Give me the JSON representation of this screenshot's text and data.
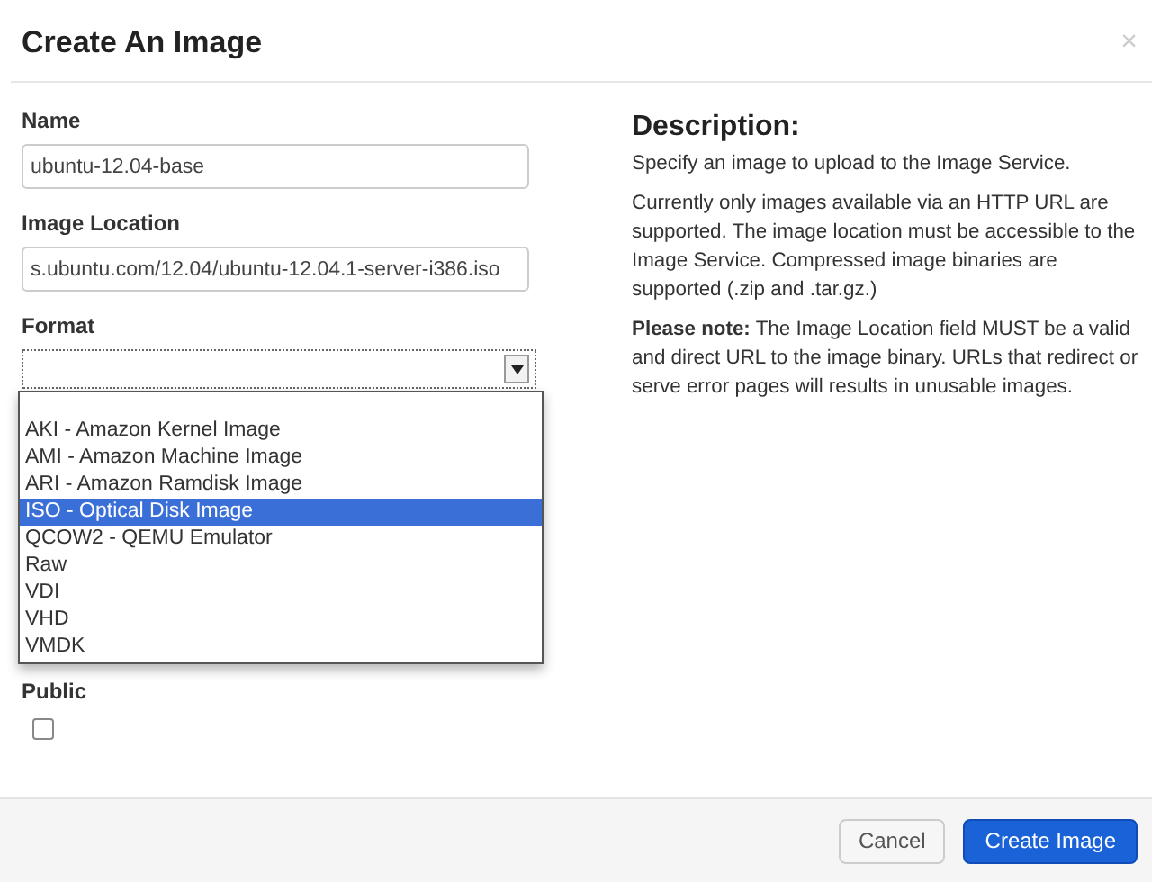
{
  "dialog": {
    "title": "Create An Image",
    "close": "×"
  },
  "fields": [
    {
      "label": "Name",
      "value": "ubuntu-12.04-base"
    },
    {
      "label": "Image Location",
      "value": "s.ubuntu.com/12.04/ubuntu-12.04.1-server-i386.iso"
    }
  ],
  "format": {
    "label": "Format",
    "expanded": true,
    "options": [
      {
        "label": "AKI - Amazon Kernel Image",
        "selected": false
      },
      {
        "label": "AMI - Amazon Machine Image",
        "selected": false
      },
      {
        "label": "ARI - Amazon Ramdisk Image",
        "selected": false
      },
      {
        "label": "ISO - Optical Disk Image",
        "selected": true
      },
      {
        "label": "QCOW2 - QEMU Emulator",
        "selected": false
      },
      {
        "label": "Raw",
        "selected": false
      },
      {
        "label": "VDI",
        "selected": false
      },
      {
        "label": "VHD",
        "selected": false
      },
      {
        "label": "VMDK",
        "selected": false
      }
    ]
  },
  "public": {
    "label": "Public",
    "checked": false
  },
  "description": {
    "heading": "Description:",
    "paragraphs": [
      "Specify an image to upload to the Image Service.",
      "Currently only images available via an HTTP URL are supported. The image location must be accessible to the Image Service. Compressed image binaries are supported (.zip and .tar.gz.)",
      "**Please note:** The Image Location field MUST be a valid and direct URL to the image binary. URLs that redirect or serve error pages will results in unusable images."
    ]
  },
  "buttons": [
    {
      "label": "Cancel",
      "kind": "secondary"
    },
    {
      "label": "Create Image",
      "kind": "primary"
    }
  ]
}
